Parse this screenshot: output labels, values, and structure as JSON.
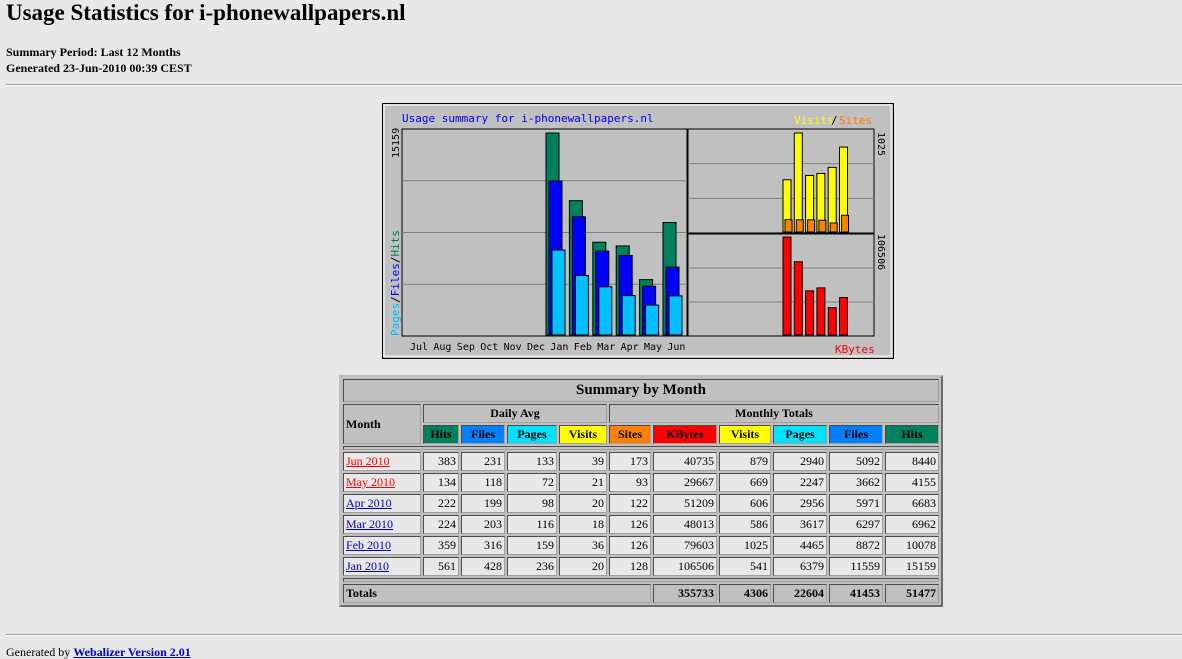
{
  "page": {
    "title": "Usage Statistics for i-phonewallpapers.nl",
    "summary_period": "Summary Period: Last 12 Months",
    "generated": "Generated 23-Jun-2010 00:39 CEST"
  },
  "chart": {
    "title": "Usage summary for i-phonewallpapers.nl",
    "left_axis_max": "15159",
    "left_axis_label_parts": [
      "Pages",
      "/",
      "Files",
      "/",
      "Hits"
    ],
    "visits_label": "Visits",
    "sites_label": "Sites",
    "slash": "/",
    "visits_axis_max": "1025",
    "kbytes_axis_max": "106506",
    "kbytes_label": "KBytes",
    "colors": {
      "hits": "#00805c",
      "files": "#0000ff",
      "pages": "#00c0ff",
      "visits": "#ffff00",
      "sites": "#ff8000",
      "kbytes": "#ff0000",
      "title": "#0000ff",
      "bg": "#c0c0c0"
    }
  },
  "chart_data": {
    "type": "bar",
    "categories": [
      "Jul",
      "Aug",
      "Sep",
      "Oct",
      "Nov",
      "Dec",
      "Jan",
      "Feb",
      "Mar",
      "Apr",
      "May",
      "Jun"
    ],
    "series": [
      {
        "name": "Hits",
        "values": [
          0,
          0,
          0,
          0,
          0,
          0,
          15159,
          10078,
          6962,
          6683,
          4155,
          8440
        ]
      },
      {
        "name": "Files",
        "values": [
          0,
          0,
          0,
          0,
          0,
          0,
          11559,
          8872,
          6297,
          5971,
          3662,
          5092
        ]
      },
      {
        "name": "Pages",
        "values": [
          0,
          0,
          0,
          0,
          0,
          0,
          6379,
          4465,
          3617,
          2956,
          2247,
          2940
        ]
      },
      {
        "name": "Visits",
        "values": [
          0,
          0,
          0,
          0,
          0,
          0,
          541,
          1025,
          586,
          606,
          669,
          879
        ]
      },
      {
        "name": "Sites",
        "values": [
          0,
          0,
          0,
          0,
          0,
          0,
          128,
          126,
          126,
          122,
          93,
          173
        ]
      },
      {
        "name": "KBytes",
        "values": [
          0,
          0,
          0,
          0,
          0,
          0,
          106506,
          79603,
          48013,
          51209,
          29667,
          40735
        ]
      }
    ],
    "title": "Usage summary for i-phonewallpapers.nl",
    "ylim_hits": [
      0,
      15159
    ],
    "ylim_visits": [
      0,
      1025
    ],
    "ylim_kbytes": [
      0,
      106506
    ]
  },
  "table": {
    "caption": "Summary by Month",
    "month_header": "Month",
    "daily_avg": "Daily Avg",
    "monthly_totals": "Monthly Totals",
    "daily_cols": [
      {
        "label": "Hits",
        "color": "#00805c"
      },
      {
        "label": "Files",
        "color": "#0080ff"
      },
      {
        "label": "Pages",
        "color": "#00e0ff"
      },
      {
        "label": "Visits",
        "color": "#ffff00"
      }
    ],
    "monthly_cols": [
      {
        "label": "Sites",
        "color": "#ff8000"
      },
      {
        "label": "KBytes",
        "color": "#ff0000"
      },
      {
        "label": "Visits",
        "color": "#ffff00"
      },
      {
        "label": "Pages",
        "color": "#00e0ff"
      },
      {
        "label": "Files",
        "color": "#0080ff"
      },
      {
        "label": "Hits",
        "color": "#00805c"
      }
    ],
    "rows": [
      {
        "month": "Jun 2010",
        "link_color": "#ff0000",
        "values": [
          "383",
          "231",
          "133",
          "39",
          "173",
          "40735",
          "879",
          "2940",
          "5092",
          "8440"
        ]
      },
      {
        "month": "May 2010",
        "link_color": "#ff0000",
        "values": [
          "134",
          "118",
          "72",
          "21",
          "93",
          "29667",
          "669",
          "2247",
          "3662",
          "4155"
        ]
      },
      {
        "month": "Apr 2010",
        "link_color": "#0000cc",
        "values": [
          "222",
          "199",
          "98",
          "20",
          "122",
          "51209",
          "606",
          "2956",
          "5971",
          "6683"
        ]
      },
      {
        "month": "Mar 2010",
        "link_color": "#0000cc",
        "values": [
          "224",
          "203",
          "116",
          "18",
          "126",
          "48013",
          "586",
          "3617",
          "6297",
          "6962"
        ]
      },
      {
        "month": "Feb 2010",
        "link_color": "#0000cc",
        "values": [
          "359",
          "316",
          "159",
          "36",
          "126",
          "79603",
          "1025",
          "4465",
          "8872",
          "10078"
        ]
      },
      {
        "month": "Jan 2010",
        "link_color": "#0000cc",
        "values": [
          "561",
          "428",
          "236",
          "20",
          "128",
          "106506",
          "541",
          "6379",
          "11559",
          "15159"
        ]
      }
    ],
    "totals_label": "Totals",
    "totals": [
      "355733",
      "4306",
      "22604",
      "41453",
      "51477"
    ]
  },
  "footer": {
    "prefix": "Generated by ",
    "link": "Webalizer Version 2.01"
  }
}
